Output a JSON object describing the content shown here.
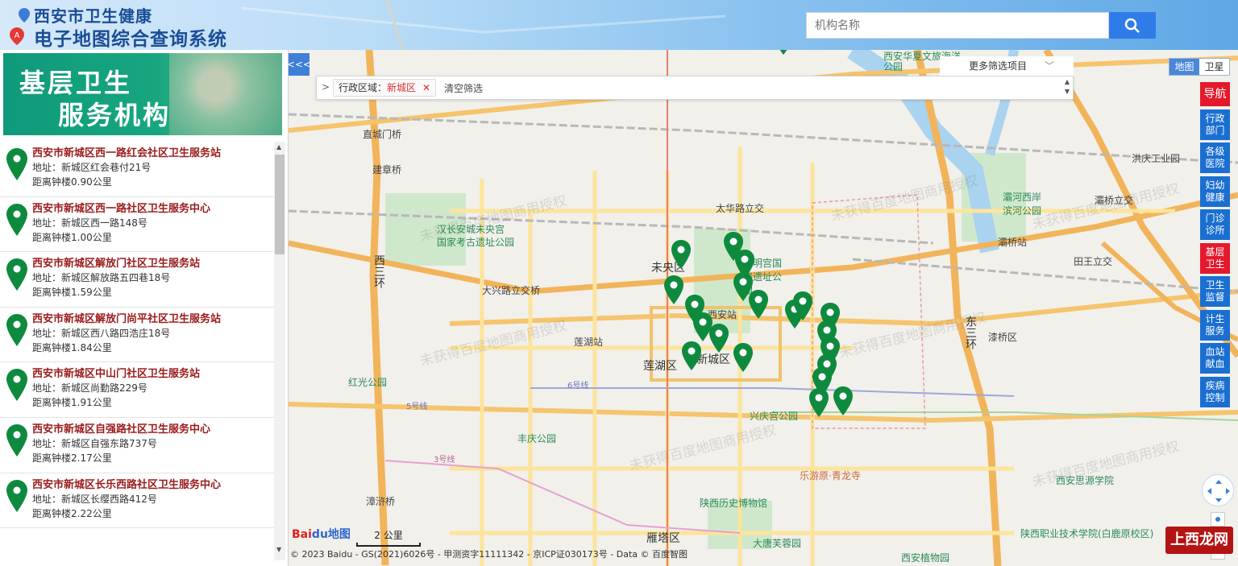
{
  "header": {
    "title_line1": "西安市卫生健康",
    "title_line2": "电子地图综合查询系统",
    "search_placeholder": "机构名称"
  },
  "left_panel": {
    "banner_line1": "基层卫生",
    "banner_line2": "服务机构",
    "facilities": [
      {
        "name": "西安市新城区西一路红会社区卫生服务站",
        "address": "地址：新城区红会巷付21号",
        "distance": "距离钟楼0.90公里"
      },
      {
        "name": "西安市新城区西一路社区卫生服务中心",
        "address": "地址：新城区西一路148号",
        "distance": "距离钟楼1.00公里"
      },
      {
        "name": "西安市新城区解放门社区卫生服务站",
        "address": "地址：新城区解放路五四巷18号",
        "distance": "距离钟楼1.59公里"
      },
      {
        "name": "西安市新城区解放门尚平社区卫生服务站",
        "address": "地址：新城区西八路四浩庄18号",
        "distance": "距离钟楼1.84公里"
      },
      {
        "name": "西安市新城区中山门社区卫生服务站",
        "address": "地址：新城区尚勤路229号",
        "distance": "距离钟楼1.91公里"
      },
      {
        "name": "西安市新城区自强路社区卫生服务中心",
        "address": "地址：新城区自强东路737号",
        "distance": "距离钟楼2.17公里"
      },
      {
        "name": "西安市新城区长乐西路社区卫生服务中心",
        "address": "地址：新城区长缨西路412号",
        "distance": "距离钟楼2.22公里"
      }
    ]
  },
  "map": {
    "collapse_label": "<<<",
    "filter": {
      "chevron": ">",
      "tag_label": "行政区域：",
      "tag_value": "新城区",
      "tag_remove": "✕",
      "clear_label": "清空筛选",
      "more_label": "更多筛选项目"
    },
    "maptype": {
      "map": "地图",
      "satellite": "卫星"
    },
    "categories": [
      "导航",
      "行政部门",
      "各级医院",
      "妇幼健康",
      "门诊诊所",
      "基层卫生",
      "卫生监督",
      "计生服务",
      "血站献血",
      "疾病控制"
    ],
    "labels": [
      {
        "text": "直城门桥"
      },
      {
        "text": "建章桥"
      },
      {
        "text": "汉长安城未央宫"
      },
      {
        "text": "国家考古遗址公园"
      },
      {
        "text": "西三环"
      },
      {
        "text": "大兴路立交桥"
      },
      {
        "text": "莲湖站"
      },
      {
        "text": "红光公园"
      },
      {
        "text": "太华路立交"
      },
      {
        "text": "未央区"
      },
      {
        "text": "大明宫国家遗址公园"
      },
      {
        "text": "西安站"
      },
      {
        "text": "莲湖区"
      },
      {
        "text": "新城区"
      },
      {
        "text": "兴庆宫公园"
      },
      {
        "text": "丰庆公园"
      },
      {
        "text": "乐游原·青龙寺"
      },
      {
        "text": "陕西历史博物馆"
      },
      {
        "text": "雁塔区"
      },
      {
        "text": "大唐芙蓉园"
      },
      {
        "text": "西安植物园"
      },
      {
        "text": "漆桥区"
      },
      {
        "text": "灞桥立交"
      },
      {
        "text": "灞桥站"
      },
      {
        "text": "田王立交"
      },
      {
        "text": "洪庆工业园"
      },
      {
        "text": "西安华夏文旅海洋公园"
      },
      {
        "text": "灞河西岸滨河公园"
      },
      {
        "text": "东三环"
      },
      {
        "text": "西安思源学院"
      },
      {
        "text": "陕西职业技术学院(白鹿原校区)"
      },
      {
        "text": "漳浒桥"
      },
      {
        "text": "6号线"
      },
      {
        "text": "5号线"
      },
      {
        "text": "3号线"
      },
      {
        "text": "西安植物园"
      }
    ],
    "watermark_text": "未获得百度地图商用授权",
    "scale_label": "2 公里",
    "logo_text": "Bai",
    "logo_text2": "du地图",
    "copyright": "© 2023 Baidu - GS(2021)6026号 - 甲测资字11111342 - 京ICP证030173号 - Data © 百度智图",
    "site_watermark": "上西龙网"
  },
  "colors": {
    "accent": "#2f7ce8",
    "pin": "#0e8a3e",
    "nav_red": "#e4192c",
    "nav_blue": "#1a6fd1",
    "title": "#1b4e96",
    "facility_name": "#9b1b1b"
  }
}
